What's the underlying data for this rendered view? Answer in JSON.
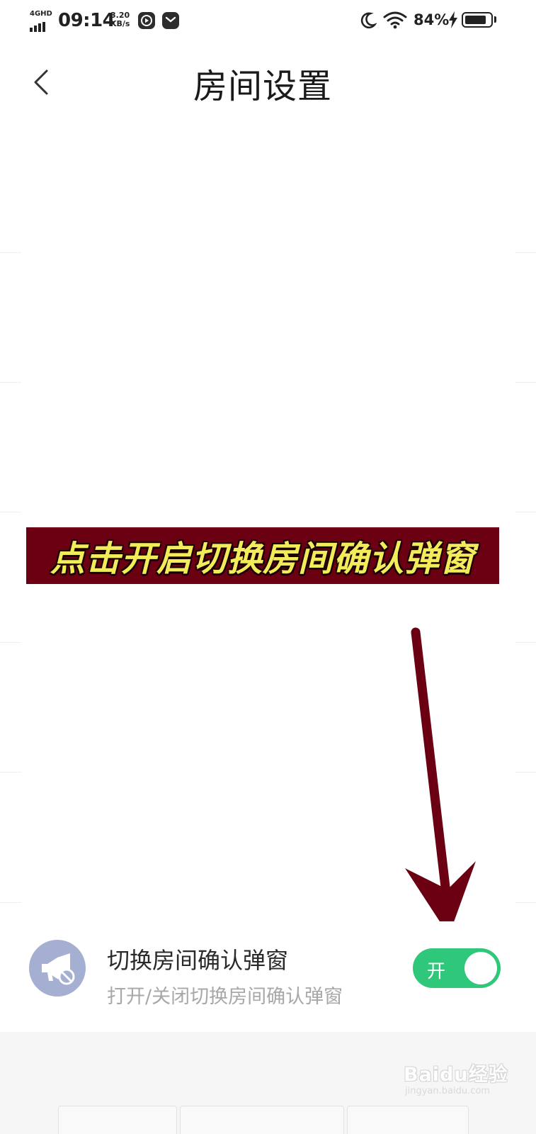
{
  "status_bar": {
    "network": "4GHD",
    "time": "09:14",
    "speed_value": "3.20",
    "speed_unit": "KB/s",
    "battery_percent": "84%",
    "battery_level": 0.84
  },
  "header": {
    "title": "房间设置",
    "back_icon": "chevron-left-icon"
  },
  "annotation": {
    "banner_text": "点击开启切换房间确认弹窗",
    "banner_bg": "#6a0012",
    "banner_text_color": "#f2ec5a",
    "arrow_color": "#6a0012"
  },
  "setting": {
    "icon": "megaphone-muted-icon",
    "title": "切换房间确认弹窗",
    "subtitle": "打开/关闭切换房间确认弹窗",
    "toggle_label": "开",
    "toggle_on": true,
    "toggle_color": "#2fc779"
  },
  "watermark": {
    "brand": "Baidu经验",
    "url": "jingyan.baidu.com"
  }
}
